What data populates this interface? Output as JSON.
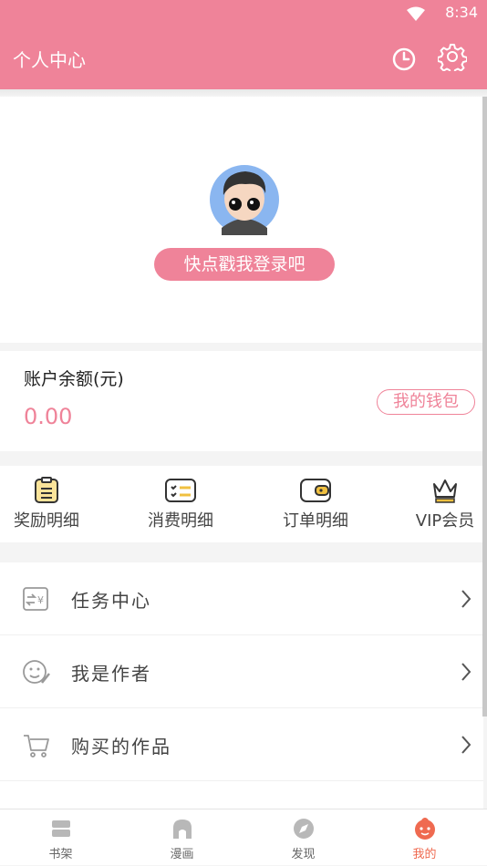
{
  "status_bar": {
    "time": "8:34"
  },
  "header": {
    "title": "个人中心"
  },
  "profile": {
    "login_label": "快点戳我登录吧"
  },
  "balance": {
    "label": "账户余额(元)",
    "amount": "0.00",
    "wallet_label": "我的钱包"
  },
  "shortcuts": [
    {
      "label": "奖励明细",
      "icon": "reward-clipboard-icon"
    },
    {
      "label": "消费明细",
      "icon": "consumption-list-icon"
    },
    {
      "label": "订单明细",
      "icon": "order-wallet-icon"
    },
    {
      "label": "VIP会员",
      "icon": "vip-crown-icon"
    }
  ],
  "menu": [
    {
      "label": "任务中心",
      "icon": "task-exchange-icon"
    },
    {
      "label": "我是作者",
      "icon": "author-face-icon"
    },
    {
      "label": "购买的作品",
      "icon": "cart-icon"
    }
  ],
  "tabs": [
    {
      "label": "书架",
      "icon": "bookshelf-icon"
    },
    {
      "label": "漫画",
      "icon": "comic-icon"
    },
    {
      "label": "发现",
      "icon": "discover-icon"
    },
    {
      "label": "我的",
      "icon": "mine-icon",
      "active": true
    }
  ],
  "colors": {
    "brand": "#ef8399",
    "active_tab": "#ef6a50"
  }
}
